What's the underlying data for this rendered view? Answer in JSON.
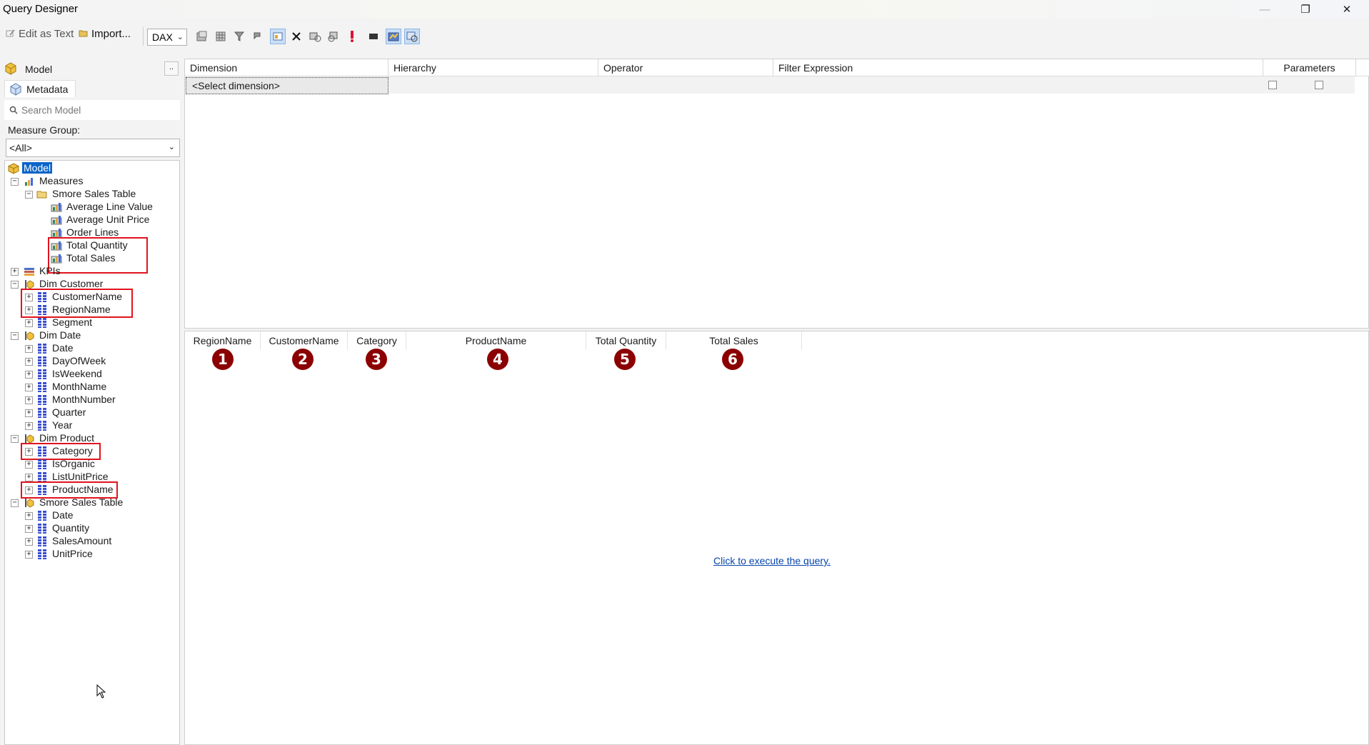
{
  "window": {
    "title": "Query Designer",
    "controls": [
      "—",
      "❐",
      "✕"
    ]
  },
  "toolbar": {
    "edit_as_text": "Edit as Text",
    "import": "Import...",
    "language": "DAX"
  },
  "left": {
    "model_label": "Model",
    "dots": "..",
    "metadata_tab": "Metadata",
    "search_placeholder": "Search Model",
    "measure_group_label": "Measure Group:",
    "measure_group_value": "<All>"
  },
  "tree": {
    "root": "Model",
    "measures": "Measures",
    "smore_sales_table": "Smore Sales Table",
    "m_avg_line": "Average Line Value",
    "m_avg_unit": "Average Unit Price",
    "m_order_lines": "Order Lines",
    "m_total_qty": "Total Quantity",
    "m_total_sales": "Total Sales",
    "kpis": "KPIs",
    "dim_customer": "Dim Customer",
    "customer_name": "CustomerName",
    "region_name": "RegionName",
    "segment": "Segment",
    "dim_date": "Dim Date",
    "date": "Date",
    "day_of_week": "DayOfWeek",
    "is_weekend": "IsWeekend",
    "month_name": "MonthName",
    "month_number": "MonthNumber",
    "quarter": "Quarter",
    "year": "Year",
    "dim_product": "Dim Product",
    "category": "Category",
    "is_organic": "IsOrganic",
    "list_unit_price": "ListUnitPrice",
    "product_name": "ProductName",
    "smore_sales_table2": "Smore Sales Table",
    "st_date": "Date",
    "st_quantity": "Quantity",
    "st_sales_amount": "SalesAmount",
    "st_unit_price": "UnitPrice"
  },
  "filter_grid": {
    "headers": [
      "Dimension",
      "Hierarchy",
      "Operator",
      "Filter Expression",
      "Parameters"
    ],
    "select_dimension": "<Select dimension>"
  },
  "results": {
    "columns": [
      "RegionName",
      "CustomerName",
      "Category",
      "ProductName",
      "Total Quantity",
      "Total Sales"
    ],
    "badges": [
      "1",
      "2",
      "3",
      "4",
      "5",
      "6"
    ],
    "execute_link": "Click to execute the query."
  },
  "colors": {
    "highlight_red": "#e0141e",
    "badge": "#8b0000",
    "selection": "#0a64c8",
    "link": "#0645ad"
  }
}
